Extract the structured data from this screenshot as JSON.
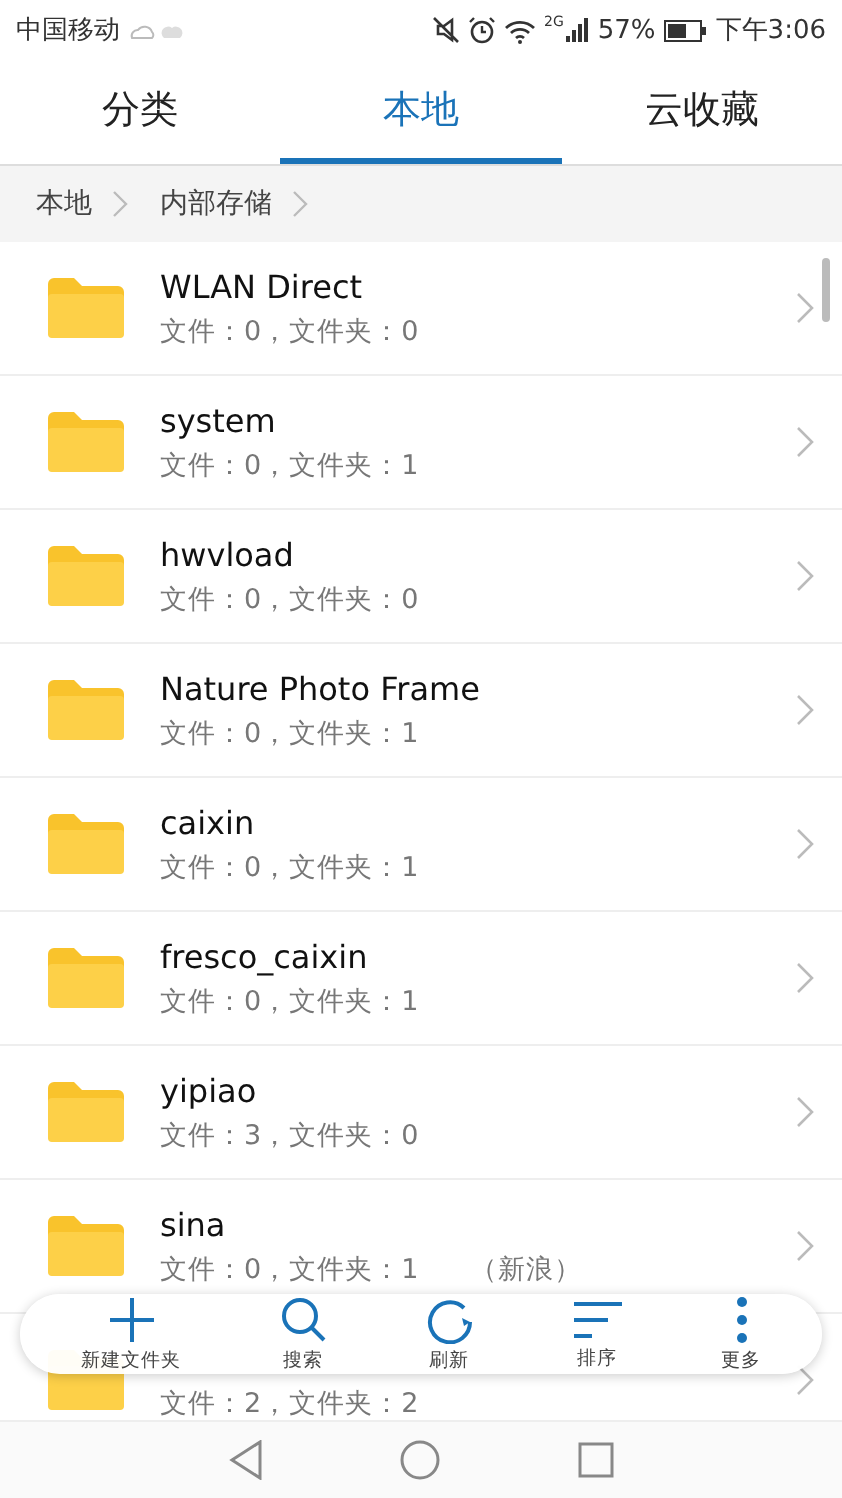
{
  "status_bar": {
    "carrier": "中国移动",
    "network": "2G",
    "battery": "57%",
    "time": "下午3:06"
  },
  "tabs": [
    {
      "label": "分类",
      "selected": false
    },
    {
      "label": "本地",
      "selected": true
    },
    {
      "label": "云收藏",
      "selected": false
    }
  ],
  "breadcrumb": [
    "本地",
    "内部存储"
  ],
  "folders": [
    {
      "name": "WLAN Direct",
      "info": "文件：0，文件夹：0"
    },
    {
      "name": "system",
      "info": "文件：0，文件夹：1"
    },
    {
      "name": "hwvload",
      "info": "文件：0，文件夹：0"
    },
    {
      "name": "Nature Photo Frame",
      "info": "文件：0，文件夹：1"
    },
    {
      "name": "caixin",
      "info": "文件：0，文件夹：1"
    },
    {
      "name": "fresco_caixin",
      "info": "文件：0，文件夹：1"
    },
    {
      "name": "yipiao",
      "info": "文件：3，文件夹：0"
    },
    {
      "name": "sina",
      "info": "文件：0，文件夹：1",
      "note": "（新浪）"
    },
    {
      "info": "文件：2，文件夹：2"
    }
  ],
  "toolbar": [
    {
      "kind": "add",
      "label": "新建文件夹"
    },
    {
      "kind": "search",
      "label": "搜索"
    },
    {
      "kind": "refresh",
      "label": "刷新"
    },
    {
      "kind": "sort",
      "label": "排序"
    },
    {
      "kind": "more",
      "label": "更多"
    }
  ]
}
